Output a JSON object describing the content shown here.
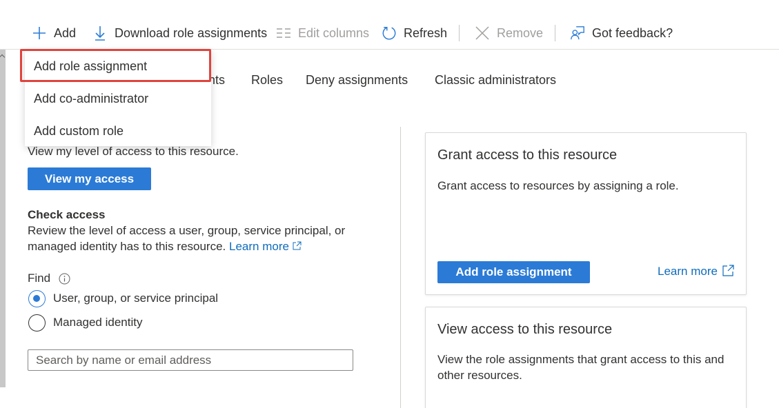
{
  "toolbar": {
    "add": "Add",
    "download": "Download role assignments",
    "edit_columns": "Edit columns",
    "refresh": "Refresh",
    "remove": "Remove",
    "feedback": "Got feedback?"
  },
  "tabs": {
    "partial": "nts",
    "roles": "Roles",
    "deny": "Deny assignments",
    "classic": "Classic administrators"
  },
  "dropdown": {
    "items": [
      "Add role assignment",
      "Add co-administrator",
      "Add custom role"
    ]
  },
  "my_access": {
    "description": "View my level of access to this resource.",
    "button": "View my access"
  },
  "check_access": {
    "title": "Check access",
    "description_line1": "Review the level of access a user, group, service principal, or",
    "description_line2": "managed identity has to this resource.",
    "learn_more": "Learn more",
    "find_label": "Find",
    "options": [
      "User, group, or service principal",
      "Managed identity"
    ],
    "selected_option": "User, group, or service principal",
    "search_placeholder": "Search by name or email address"
  },
  "grant_card": {
    "title": "Grant access to this resource",
    "description": "Grant access to resources by assigning a role.",
    "button": "Add role assignment",
    "learn_more": "Learn more"
  },
  "view_card": {
    "title": "View access to this resource",
    "description_line1": "View the role assignments that grant access to this and",
    "description_line2": "other resources."
  },
  "colors": {
    "accent": "#2b7bd6",
    "link": "#0f6cbd",
    "highlight": "#e0433e"
  }
}
